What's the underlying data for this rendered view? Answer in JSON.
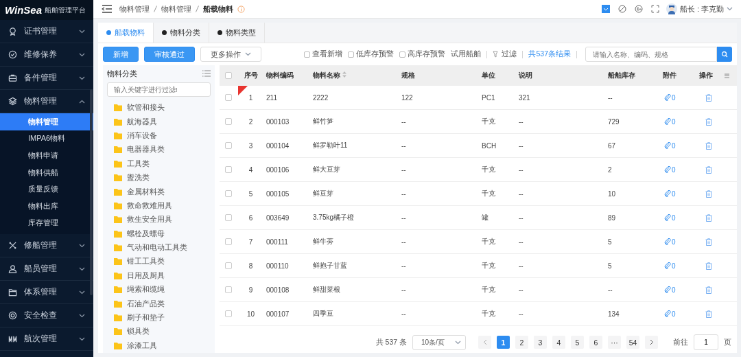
{
  "logo": {
    "brand": "WinSea",
    "subtitle": "船舶管理平台"
  },
  "sidebar": {
    "items": [
      {
        "label": "证书管理",
        "expanded": false
      },
      {
        "label": "维修保养",
        "expanded": false
      },
      {
        "label": "备件管理",
        "expanded": false
      },
      {
        "label": "物料管理",
        "expanded": true,
        "children": [
          {
            "label": "物料管理",
            "selected": true
          },
          {
            "label": "IMPA6物料",
            "selected": false
          },
          {
            "label": "物料申请",
            "selected": false
          },
          {
            "label": "物料供船",
            "selected": false
          },
          {
            "label": "质量反馈",
            "selected": false
          },
          {
            "label": "物料出库",
            "selected": false
          },
          {
            "label": "库存管理",
            "selected": false
          }
        ]
      },
      {
        "label": "修船管理",
        "expanded": false
      },
      {
        "label": "船员管理",
        "expanded": false
      },
      {
        "label": "体系管理",
        "expanded": false
      },
      {
        "label": "安全检查",
        "expanded": false
      },
      {
        "label": "航次管理",
        "expanded": false
      }
    ]
  },
  "breadcrumb": [
    "物料管理",
    "物料管理",
    "船载物料"
  ],
  "user": {
    "name": "船长 : 李克勤"
  },
  "tabs": [
    {
      "label": "船载物料",
      "selected": true
    },
    {
      "label": "物料分类",
      "selected": false
    },
    {
      "label": "物料类型",
      "selected": false
    }
  ],
  "toolbar": {
    "buttons": [
      {
        "label": "新增",
        "kind": "primary"
      },
      {
        "label": "审核通过",
        "kind": "primary"
      },
      {
        "label": "更多操作",
        "kind": "dropdown"
      }
    ],
    "checkboxes": [
      {
        "label": "查看新增",
        "checked": false
      },
      {
        "label": "低库存预警",
        "checked": false
      },
      {
        "label": "高库存预警",
        "checked": false
      }
    ],
    "vessel_link": "试用船舶",
    "filter": "过滤",
    "result_count": "共537条结果",
    "search": {
      "placeholder": "请输入名称、编码、规格"
    }
  },
  "category_tree": {
    "title": "物料分类",
    "search": {
      "placeholder": "输入关键字进行过滤!"
    },
    "items": [
      "软管和接头",
      "航海器具",
      "消车设备",
      "电器器具类",
      "工具类",
      "盥洗类",
      "金属材料类",
      "救命救难用具",
      "救生安全用具",
      "螺栓及螺母",
      "气动和电动工具类",
      "钳工工具类",
      "日用及厨具",
      "绳索和缆绳",
      "石油产品类",
      "刷子和垫子",
      "锁具类",
      "涂漆工具"
    ]
  },
  "table": {
    "select_all_checked": false,
    "columns": [
      "序号",
      "物料编码",
      "物料名称",
      "规格",
      "单位",
      "说明",
      "船舶库存",
      "附件",
      "操作"
    ],
    "rows": [
      {
        "index": "1",
        "code": "211",
        "name": "2222",
        "spec": "122",
        "unit": "PC1",
        "note": "321",
        "stock": "--",
        "attachments": "0",
        "is_new": true,
        "checked": false
      },
      {
        "index": "2",
        "code": "000103",
        "name": "鲜竹笋",
        "spec": "--",
        "unit": "千克",
        "note": "--",
        "stock": "729",
        "attachments": "0",
        "is_new": false,
        "checked": false
      },
      {
        "index": "3",
        "code": "000104",
        "name": "鲜罗勒叶11",
        "spec": "--",
        "unit": "BCH",
        "note": "--",
        "stock": "67",
        "attachments": "0",
        "is_new": false,
        "checked": false
      },
      {
        "index": "4",
        "code": "000106",
        "name": "鲜大豆芽",
        "spec": "--",
        "unit": "千克",
        "note": "--",
        "stock": "2",
        "attachments": "0",
        "is_new": false,
        "checked": false
      },
      {
        "index": "5",
        "code": "000105",
        "name": "鲜豆芽",
        "spec": "--",
        "unit": "千克",
        "note": "--",
        "stock": "10",
        "attachments": "0",
        "is_new": false,
        "checked": false
      },
      {
        "index": "6",
        "code": "003649",
        "name": "3.75kg橘子橙",
        "spec": "--",
        "unit": "罐",
        "note": "--",
        "stock": "89",
        "attachments": "0",
        "is_new": false,
        "checked": false
      },
      {
        "index": "7",
        "code": "000111",
        "name": "鲜牛蒡",
        "spec": "--",
        "unit": "千克",
        "note": "--",
        "stock": "5",
        "attachments": "0",
        "is_new": false,
        "checked": false
      },
      {
        "index": "8",
        "code": "000110",
        "name": "鲜抱子甘蓝",
        "spec": "--",
        "unit": "千克",
        "note": "--",
        "stock": "5",
        "attachments": "0",
        "is_new": false,
        "checked": false
      },
      {
        "index": "9",
        "code": "000108",
        "name": "鲜甜菜根",
        "spec": "--",
        "unit": "千克",
        "note": "--",
        "stock": "--",
        "attachments": "0",
        "is_new": false,
        "checked": false
      },
      {
        "index": "10",
        "code": "000107",
        "name": "四季豆",
        "spec": "--",
        "unit": "千克",
        "note": "--",
        "stock": "134",
        "attachments": "0",
        "is_new": false,
        "checked": false
      }
    ]
  },
  "pagination": {
    "total": "共 537 条",
    "page_size": "10条/页",
    "pages": [
      {
        "label": "1",
        "selected": true
      },
      {
        "label": "2",
        "selected": false
      },
      {
        "label": "3",
        "selected": false
      },
      {
        "label": "4",
        "selected": false
      },
      {
        "label": "5",
        "selected": false
      },
      {
        "label": "6",
        "selected": false
      },
      {
        "label": "···",
        "selected": false
      },
      {
        "label": "54",
        "selected": false
      }
    ],
    "goto_label": "前往",
    "goto_value": "1",
    "page_unit": "页"
  }
}
